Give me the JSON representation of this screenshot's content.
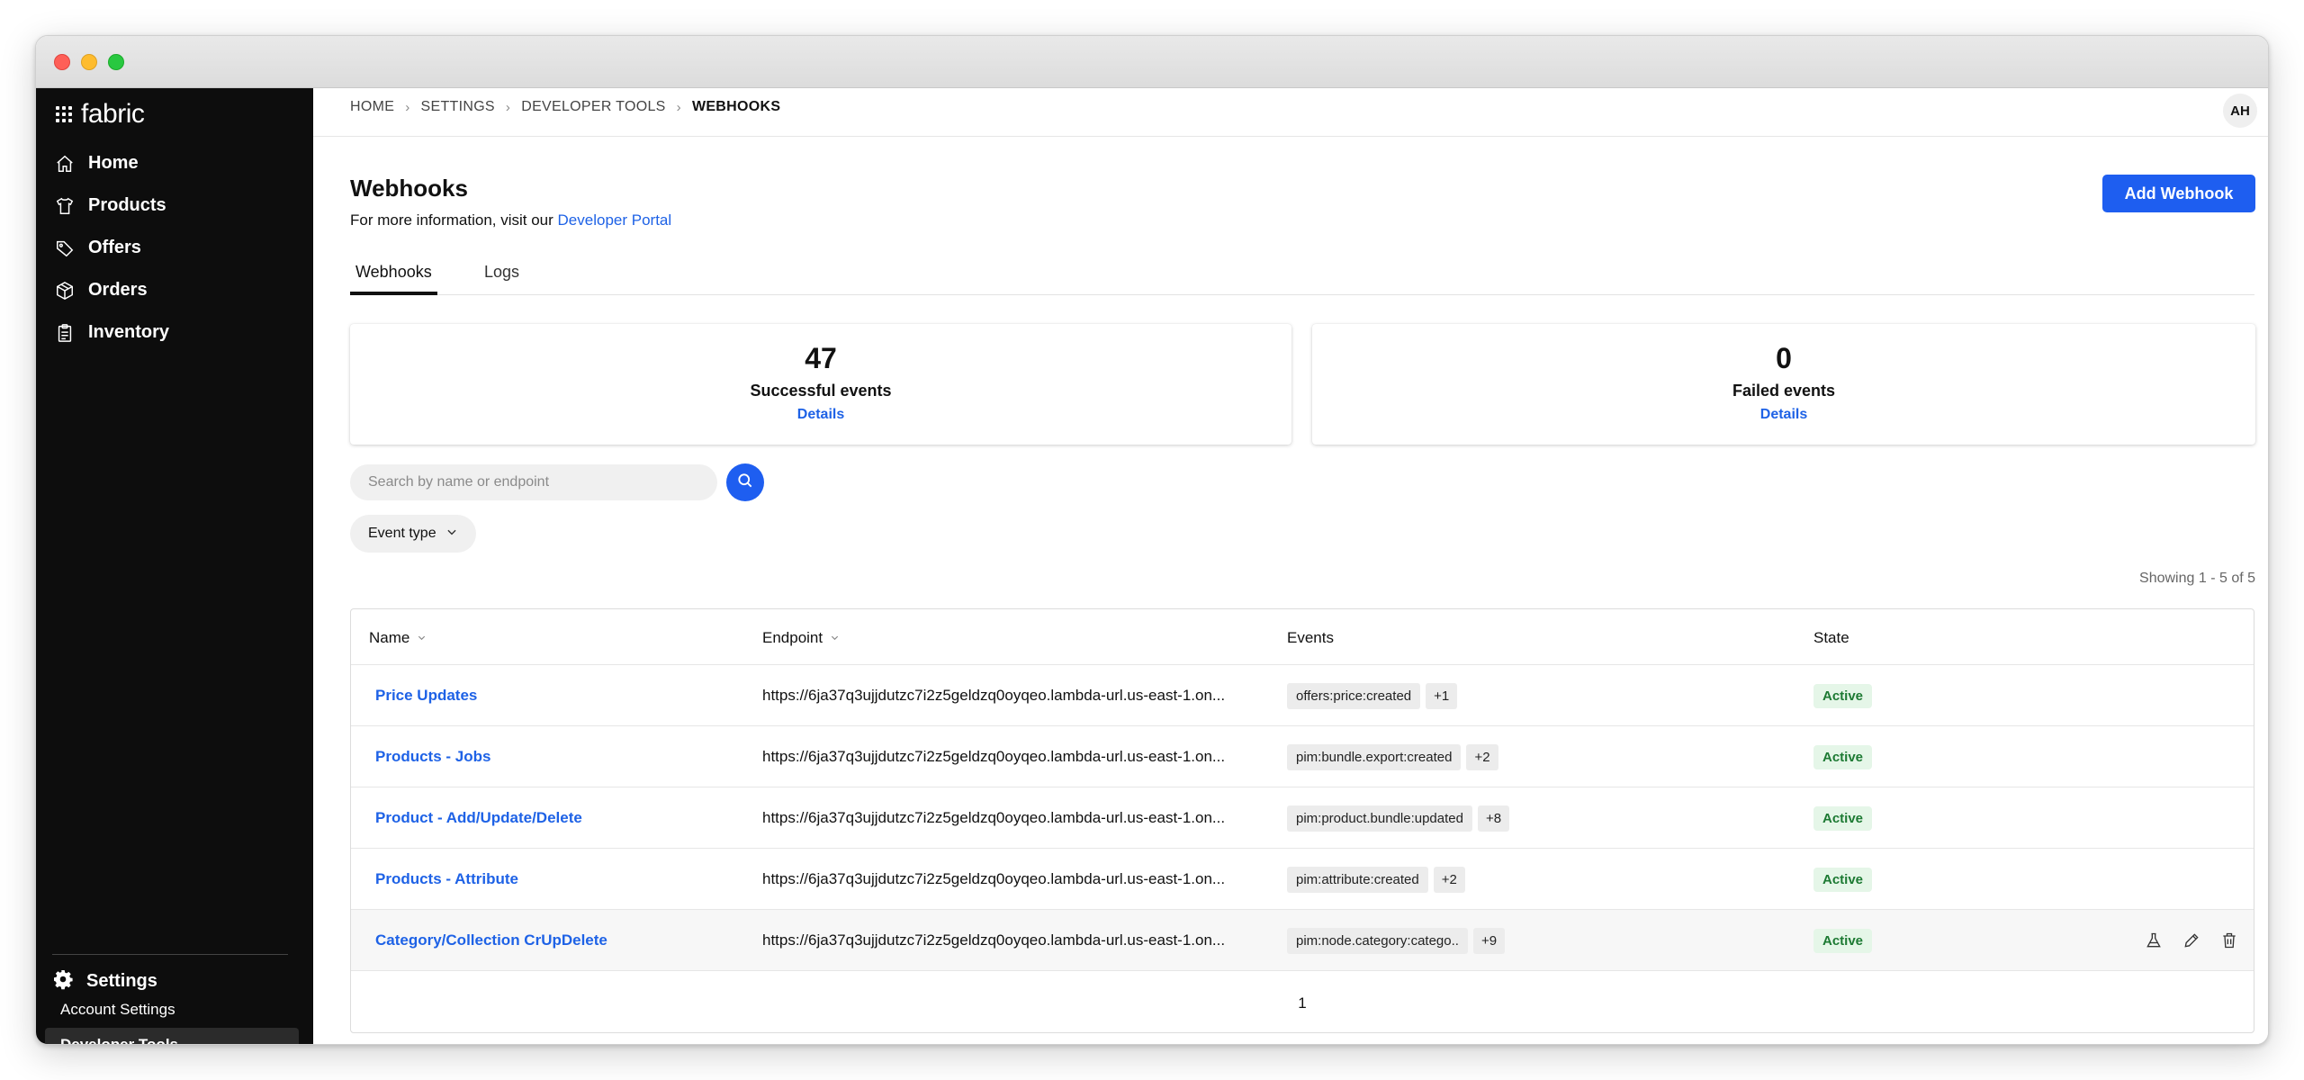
{
  "brand": {
    "name": "fabric"
  },
  "sidebar": {
    "items": [
      {
        "label": "Home",
        "icon": "home-icon"
      },
      {
        "label": "Products",
        "icon": "tshirt-icon"
      },
      {
        "label": "Offers",
        "icon": "tag-icon"
      },
      {
        "label": "Orders",
        "icon": "box-icon"
      },
      {
        "label": "Inventory",
        "icon": "clipboard-icon"
      }
    ],
    "settings_label": "Settings",
    "sub_items": [
      {
        "label": "Account Settings"
      },
      {
        "label": "Developer Tools",
        "active": true
      }
    ]
  },
  "breadcrumb": [
    "HOME",
    "SETTINGS",
    "DEVELOPER TOOLS",
    "WEBHOOKS"
  ],
  "user": {
    "initials": "AH"
  },
  "page": {
    "title": "Webhooks",
    "info_prefix": "For more information, visit our",
    "info_link": "Developer Portal",
    "add_button": "Add Webhook"
  },
  "tabs": [
    {
      "label": "Webhooks",
      "active": true
    },
    {
      "label": "Logs",
      "active": false
    }
  ],
  "stats": [
    {
      "value": "47",
      "caption": "Successful events",
      "link": "Details"
    },
    {
      "value": "0",
      "caption": "Failed events",
      "link": "Details"
    }
  ],
  "search": {
    "placeholder": "Search by name or endpoint",
    "value": ""
  },
  "filter": {
    "label": "Event type"
  },
  "showing": "Showing 1 - 5 of 5",
  "table": {
    "columns": [
      "Name",
      "Endpoint",
      "Events",
      "State"
    ],
    "rows": [
      {
        "name": "Price Updates",
        "endpoint": "https://6ja37q3ujjdutzc7i2z5geldzq0oyqeo.lambda-url.us-east-1.on...",
        "event": "offers:price:created",
        "more": "+1",
        "state": "Active"
      },
      {
        "name": "Products - Jobs",
        "endpoint": "https://6ja37q3ujjdutzc7i2z5geldzq0oyqeo.lambda-url.us-east-1.on...",
        "event": "pim:bundle.export:created",
        "more": "+2",
        "state": "Active"
      },
      {
        "name": "Product - Add/Update/Delete",
        "endpoint": "https://6ja37q3ujjdutzc7i2z5geldzq0oyqeo.lambda-url.us-east-1.on...",
        "event": "pim:product.bundle:updated",
        "more": "+8",
        "state": "Active"
      },
      {
        "name": "Products - Attribute",
        "endpoint": "https://6ja37q3ujjdutzc7i2z5geldzq0oyqeo.lambda-url.us-east-1.on...",
        "event": "pim:attribute:created",
        "more": "+2",
        "state": "Active"
      },
      {
        "name": "Category/Collection CrUpDelete",
        "endpoint": "https://6ja37q3ujjdutzc7i2z5geldzq0oyqeo.lambda-url.us-east-1.on...",
        "event": "pim:node.category:catego..",
        "more": "+9",
        "state": "Active"
      }
    ],
    "page": "1"
  },
  "colors": {
    "accent": "#1e5ef0",
    "link": "#1e62e6",
    "active_bg": "#e5f6e8",
    "active_text": "#1d7a33",
    "sidebar_bg": "#0d0d0d"
  }
}
